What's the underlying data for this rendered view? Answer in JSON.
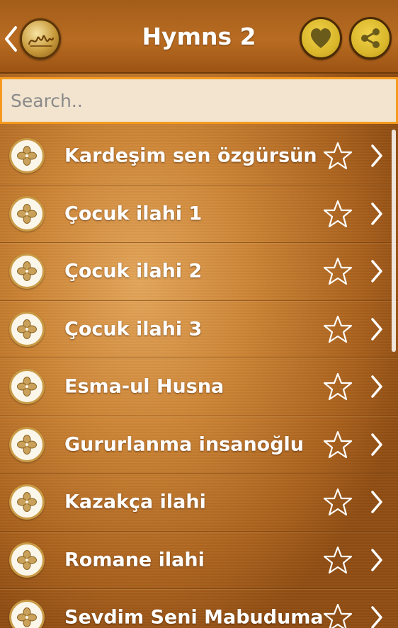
{
  "header": {
    "title": "Hymns 2",
    "back_icon": "chevron-left-icon",
    "logo_icon": "allah-calligraphy-logo",
    "favorites_icon": "heart-icon",
    "share_icon": "share-icon"
  },
  "search": {
    "placeholder": "Search..",
    "value": ""
  },
  "list": {
    "items": [
      {
        "label": "Kardeşim sen özgürsün"
      },
      {
        "label": "Çocuk ilahi 1"
      },
      {
        "label": "Çocuk ilahi 2"
      },
      {
        "label": "Çocuk ilahi 3"
      },
      {
        "label": "Esma-ul Husna"
      },
      {
        "label": "Gururlanma insanoğlu"
      },
      {
        "label": "Kazakça ilahi"
      },
      {
        "label": "Romane ilahi"
      },
      {
        "label": "Sevdim Seni Mabuduma"
      }
    ]
  },
  "colors": {
    "accent_orange": "#f59a1f",
    "button_gold": "#dab72b",
    "text_white": "#ffffff"
  }
}
